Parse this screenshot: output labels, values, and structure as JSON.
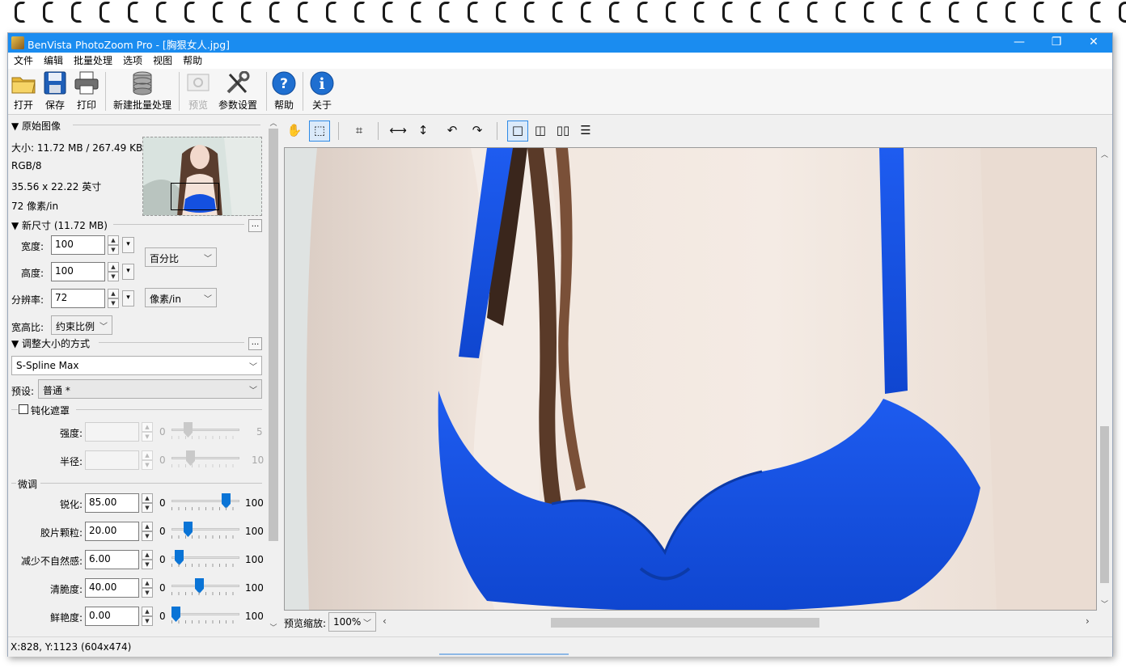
{
  "window": {
    "title": "BenVista PhotoZoom Pro  - [胸狠女人.jpg]",
    "controls": {
      "minimize": "—",
      "maximize": "❐",
      "close": "✕"
    }
  },
  "menu": [
    "文件",
    "编辑",
    "批量处理",
    "选项",
    "视图",
    "帮助"
  ],
  "toolbar": {
    "open": "打开",
    "save": "保存",
    "print": "打印",
    "new_batch": "新建批量处理",
    "preview": "预览",
    "settings": "参数设置",
    "help": "帮助",
    "about": "关于"
  },
  "original": {
    "header": "▼ 原始图像",
    "size": "大小: 11.72 MB / 267.49 KB",
    "mode": "RGB/8",
    "dimensions": "35.56 x 22.22 英寸",
    "resolution": "72 像素/in"
  },
  "new_size": {
    "header": "▼ 新尺寸 (11.72 MB)",
    "more": "...",
    "width_label": "宽度:",
    "width": "100",
    "height_label": "高度:",
    "height": "100",
    "resolution_label": "分辨率:",
    "resolution": "72",
    "unit_size": "百分比",
    "unit_res": "像素/in",
    "aspect_label": "宽高比:",
    "aspect": "约束比例"
  },
  "resize": {
    "header": "▼ 调整大小的方式",
    "more": "...",
    "method": "S-Spline Max",
    "preset_label": "预设:",
    "preset": "普通 *"
  },
  "unsharp": {
    "label": "钝化遮罩",
    "strength_label": "强度:",
    "strength_min": "0",
    "strength_max": "5",
    "radius_label": "半径:",
    "radius_min": "0",
    "radius_max": "10"
  },
  "finetune": {
    "header": "微调",
    "rows": [
      {
        "label": "锐化:",
        "value": "85.00",
        "min": "0",
        "max": "100",
        "level": 0.85
      },
      {
        "label": "胶片颗粒:",
        "value": "20.00",
        "min": "0",
        "max": "100",
        "level": 0.2
      },
      {
        "label": "减少不自然感:",
        "value": "6.00",
        "min": "0",
        "max": "100",
        "level": 0.06
      },
      {
        "label": "清脆度:",
        "value": "40.00",
        "min": "0",
        "max": "100",
        "level": 0.4
      },
      {
        "label": "鲜艳度:",
        "value": "0.00",
        "min": "0",
        "max": "100",
        "level": 0.0
      }
    ]
  },
  "preview": {
    "zoom_label": "预览缩放:",
    "zoom": "100%"
  },
  "status": {
    "coords": "X:828, Y:1123",
    "size": "(604x474)"
  },
  "colors": {
    "titlebar": "#1a8cf0",
    "accent": "#0a74d6",
    "swimsuit": "#1450e0"
  }
}
